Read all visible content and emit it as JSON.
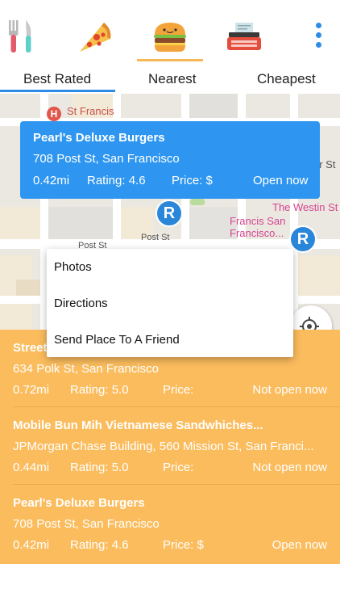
{
  "categories": [
    {
      "name": "restaurant",
      "icon": "fork-knife-icon"
    },
    {
      "name": "pizza",
      "icon": "pizza-icon"
    },
    {
      "name": "burger",
      "icon": "burger-icon",
      "selected": true
    },
    {
      "name": "typewriter",
      "icon": "typewriter-icon"
    }
  ],
  "tabs": {
    "best_rated": "Best Rated",
    "nearest": "Nearest",
    "cheapest": "Cheapest"
  },
  "map": {
    "labels": {
      "st_francis": "St Francis",
      "westin_line1": "The Westin St",
      "westin_line2": "Francis San Francisco...",
      "post_st_1": "Post St",
      "post_st_2": "Post St",
      "er_st": "er St"
    },
    "hospital_glyph": "H",
    "pin_letter": "R"
  },
  "info_card": {
    "name": "Pearl's Deluxe Burgers",
    "address": "708 Post St, San Francisco",
    "distance": "0.42mi",
    "rating": "Rating: 4.6",
    "price": "Price: $",
    "status": "Open now"
  },
  "context_menu": {
    "photos": "Photos",
    "directions": "Directions",
    "send": "Send Place To A Friend"
  },
  "list": [
    {
      "name": "Street",
      "address": "634 Polk St, San Francisco",
      "distance": "0.72mi",
      "rating": "Rating: 5.0",
      "price": "Price:",
      "status": "Not open now"
    },
    {
      "name": "Mobile Bun Mih Vietnamese Sandwhiches...",
      "address": "JPMorgan Chase Building, 560 Mission St, San Franci...",
      "distance": "0.44mi",
      "rating": "Rating: 5.0",
      "price": "Price:",
      "status": "Not open now"
    },
    {
      "name": "Pearl's Deluxe Burgers",
      "address": "708 Post St, San Francisco",
      "distance": "0.42mi",
      "rating": "Rating: 4.6",
      "price": "Price: $",
      "status": "Open now"
    }
  ],
  "colors": {
    "accent_blue": "#2e96f0",
    "list_orange": "#fbbc5d",
    "selected_underline": "#f7b757"
  }
}
